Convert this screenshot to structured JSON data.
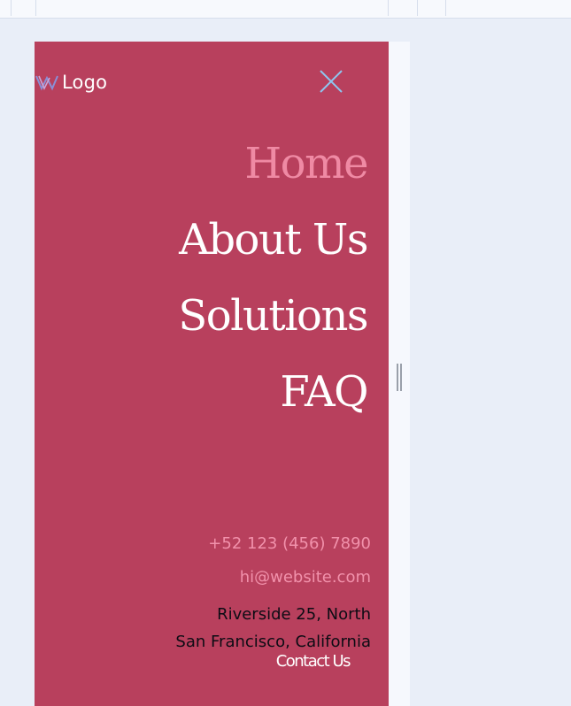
{
  "header": {
    "logo_text": "Logo",
    "logo_icon": "w-logo-icon",
    "close_icon": "close-icon"
  },
  "nav": {
    "items": [
      {
        "label": "Home",
        "active": true
      },
      {
        "label": "About Us",
        "active": false
      },
      {
        "label": "Solutions",
        "active": false
      },
      {
        "label": "FAQ",
        "active": false
      },
      {
        "label": "Contact Us",
        "active": false
      }
    ]
  },
  "contact": {
    "phone": "+52 123 (456) 7890",
    "email": "hi@website.com",
    "address_line1": "Riverside 25, North",
    "address_line2": "San Francisco, California"
  },
  "colors": {
    "menu_background": "#b8405d",
    "active_link": "#ef8aa4",
    "contact_link": "#f191ab",
    "close_icon": "#8ec6f0",
    "page_background": "#e9eef8"
  }
}
